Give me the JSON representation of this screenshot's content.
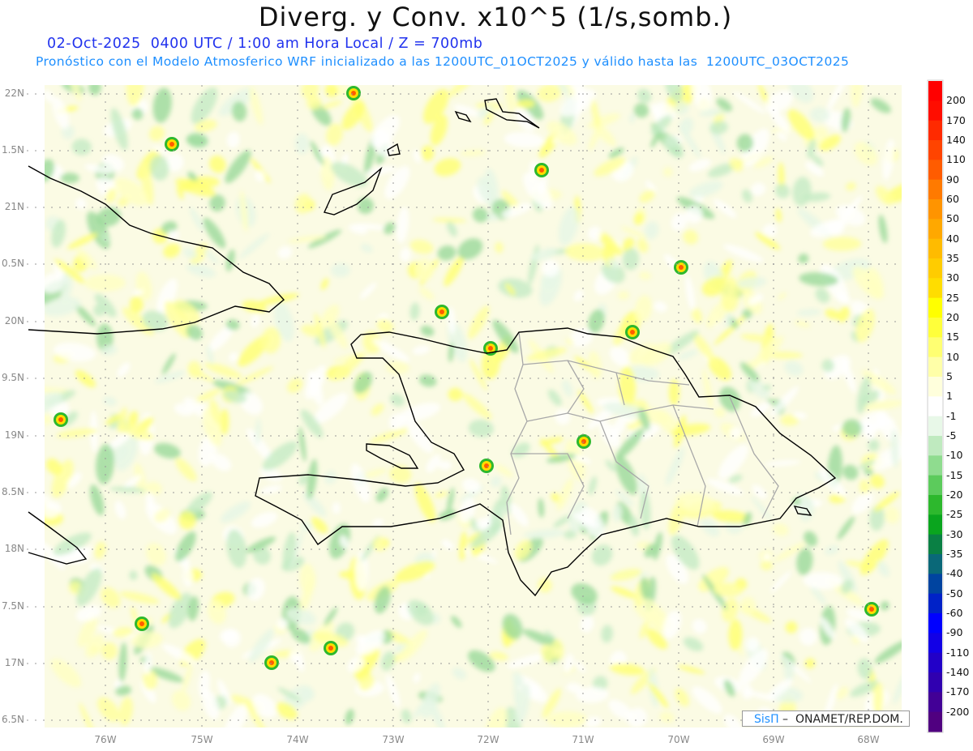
{
  "title": "Diverg. y Conv. x10^5 (1/s,somb.)",
  "subtitle_line1": "02-Oct-2025  0400 UTC / 1:00 am Hora Local / Z = 700mb",
  "subtitle_line2": "Pronóstico con el Modelo Atmosferico WRF inicializado a las 1200UTC_01OCT2025 y válido hasta las  1200UTC_03OCT2025",
  "lat_labels": [
    "22N",
    "1.5N",
    "21N",
    "0.5N",
    "20N",
    "9.5N",
    "19N",
    "8.5N",
    "18N",
    "7.5N",
    "17N",
    "6.5N"
  ],
  "lon_labels": [
    "76W",
    "75W",
    "74W",
    "73W",
    "72W",
    "71W",
    "70W",
    "69W",
    "68W"
  ],
  "colorbar": {
    "labels": [
      "200",
      "170",
      "140",
      "110",
      "90",
      "60",
      "50",
      "40",
      "35",
      "30",
      "25",
      "20",
      "15",
      "10",
      "5",
      "1",
      "-1",
      "-5",
      "-10",
      "-15",
      "-20",
      "-25",
      "-30",
      "-35",
      "-40",
      "-50",
      "-60",
      "-90",
      "-110",
      "-140",
      "-170",
      "-200"
    ],
    "colors": [
      "#ff0000",
      "#ff0d00",
      "#ff2a00",
      "#ff4400",
      "#ff5c00",
      "#ff7a00",
      "#ff9400",
      "#ffa800",
      "#ffbb00",
      "#ffcc00",
      "#ffdd00",
      "#ffff00",
      "#ffff3a",
      "#ffff72",
      "#ffffa8",
      "#ffffdc",
      "#ffffff",
      "#e8f8e8",
      "#bfeabf",
      "#8fdc8f",
      "#5ccb5c",
      "#2db82d",
      "#0aa51e",
      "#0a8044",
      "#0a6878",
      "#0044a0",
      "#0022c8",
      "#0000ff",
      "#1200e6",
      "#2200c8",
      "#3000b0",
      "#420096",
      "#500080"
    ]
  },
  "credit": {
    "logo": "SisΠ",
    "text": " –  ONAMET/REP.DOM."
  }
}
